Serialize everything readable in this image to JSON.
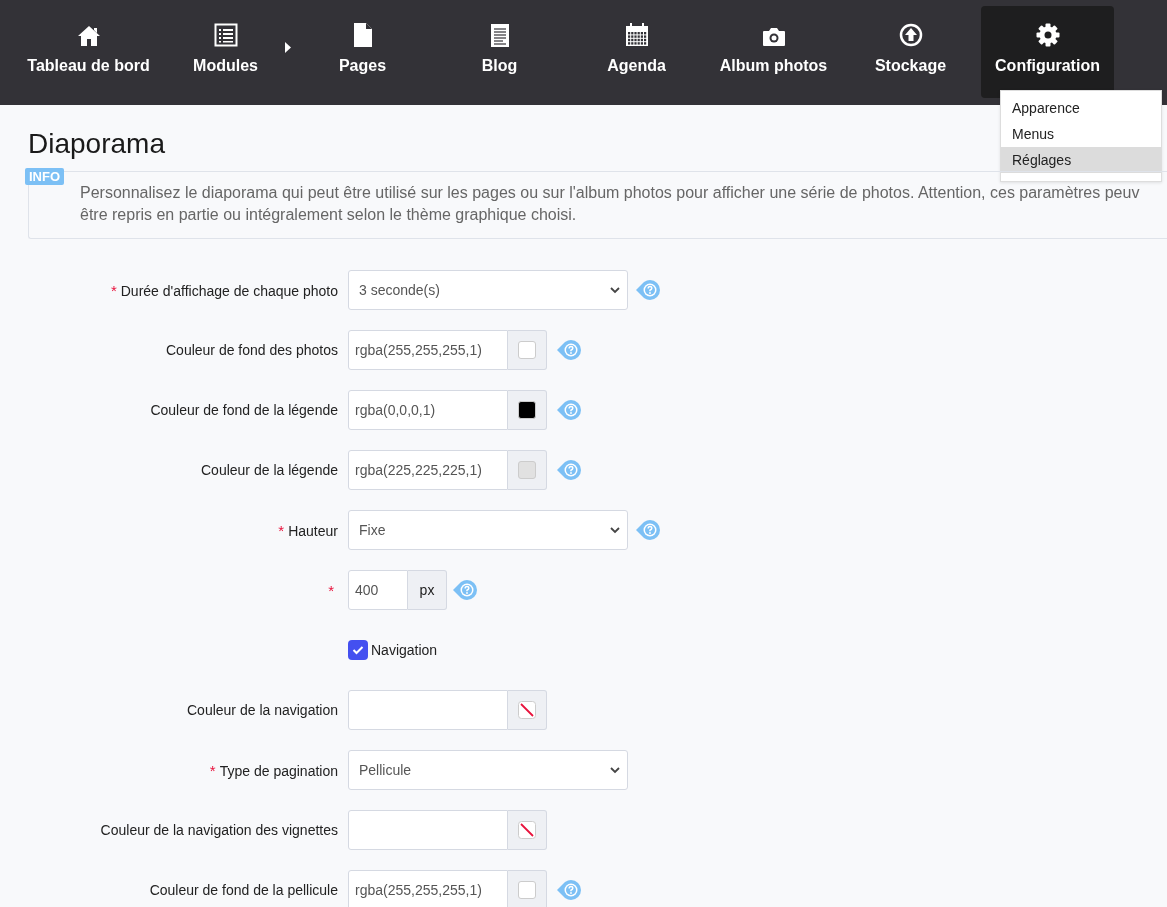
{
  "nav": {
    "items": [
      {
        "label": "Tableau de bord",
        "selected": false,
        "has_submenu": false
      },
      {
        "label": "Modules",
        "selected": false,
        "has_submenu": true
      },
      {
        "label": "Pages",
        "selected": false,
        "has_submenu": false
      },
      {
        "label": "Blog",
        "selected": false,
        "has_submenu": false
      },
      {
        "label": "Agenda",
        "selected": false,
        "has_submenu": false
      },
      {
        "label": "Album photos",
        "selected": false,
        "has_submenu": false
      },
      {
        "label": "Stockage",
        "selected": false,
        "has_submenu": false
      },
      {
        "label": "Configuration",
        "selected": true,
        "has_submenu": false
      }
    ],
    "dropdown": [
      {
        "label": "Apparence",
        "selected": false
      },
      {
        "label": "Menus",
        "selected": false
      },
      {
        "label": "Réglages",
        "selected": true
      }
    ]
  },
  "page": {
    "title": "Diaporama",
    "info": {
      "badge": "INFO",
      "lines": [
        "Personnalisez le diaporama qui peut être utilisé sur les pages ou sur l'album photos pour afficher une série de photos. Attention, ces paramètres peuv",
        "être repris en partie ou intégralement selon le thème graphique choisi."
      ]
    },
    "fields": [
      {
        "kind": "select",
        "required_mark": "*",
        "label": "Durée d'affichage de chaque photo",
        "value": "3 seconde(s)",
        "help": true
      },
      {
        "kind": "color",
        "label": "Couleur de fond des photos",
        "value": "rgba(255,255,255,1)",
        "color": "#ffffff",
        "help": true
      },
      {
        "kind": "color",
        "label": "Couleur de fond de la légende",
        "value": "rgba(0,0,0,1)",
        "color": "#000000",
        "help": true
      },
      {
        "kind": "color",
        "label": "Couleur de la légende",
        "value": "rgba(225,225,225,1)",
        "color": "#e1e1e1",
        "help": true
      },
      {
        "kind": "select",
        "required_mark": "*",
        "label": "Hauteur",
        "value": "Fixe",
        "help": true
      },
      {
        "kind": "unit",
        "required_mark": "*",
        "value": "400",
        "unit": "px",
        "help": true
      },
      {
        "kind": "checkbox",
        "label": "Navigation",
        "checked": true
      },
      {
        "kind": "color",
        "label": "Couleur de la navigation",
        "help": false
      },
      {
        "kind": "select",
        "required_mark": "*",
        "label": "Type de pagination",
        "value": "Pellicule",
        "help": false
      },
      {
        "kind": "color",
        "label": "Couleur de la navigation des vignettes",
        "help": false
      },
      {
        "kind": "color",
        "label": "Couleur de fond de la pellicule",
        "value": "rgba(255,255,255,1)",
        "color": "#ffffff",
        "help": true
      }
    ]
  }
}
